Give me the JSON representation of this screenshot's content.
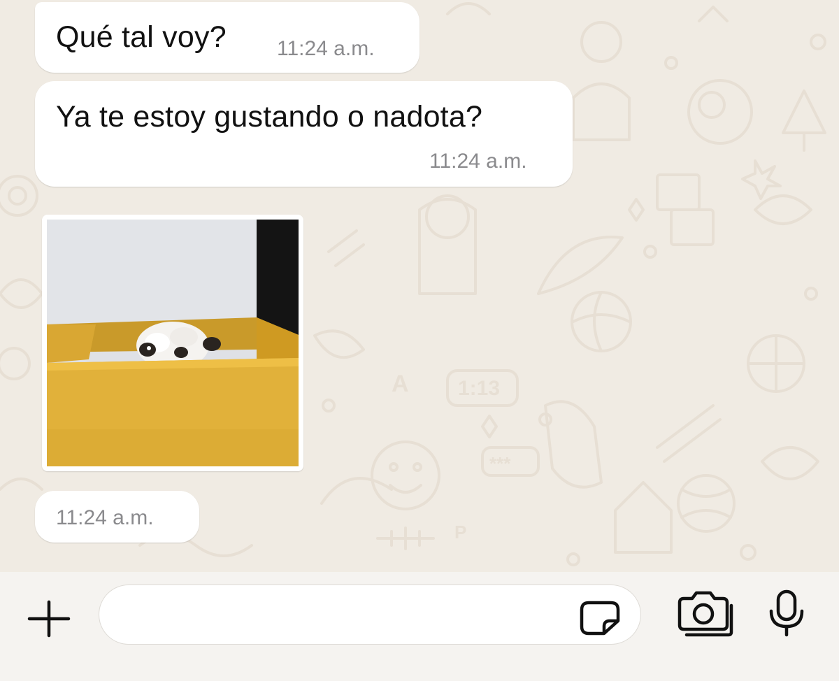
{
  "messages": [
    {
      "text": "Qué tal voy?",
      "time": "11:24 a.m."
    },
    {
      "text": "Ya te estoy gustando o nadota?",
      "time": "11:24 a.m."
    },
    {
      "image": "puppy-peeking-from-yellow-box",
      "time": "11:24 a.m."
    }
  ],
  "wallpaper_doodles": {
    "clock_text": "1:13",
    "password_text": "***",
    "letter_glyph": "A",
    "parking_glyph": "P"
  },
  "input": {
    "placeholder": "",
    "value": ""
  },
  "icons": {
    "attach": "plus-icon",
    "sticker": "sticker-icon",
    "camera": "camera-icon",
    "voice": "microphone-icon"
  },
  "colors": {
    "wallpaper": "#f0ebe3",
    "doodle": "#e7dfd4",
    "bubble": "#ffffff",
    "timestamp": "#8a8a8d",
    "box_yellow": "#e1b13a"
  }
}
